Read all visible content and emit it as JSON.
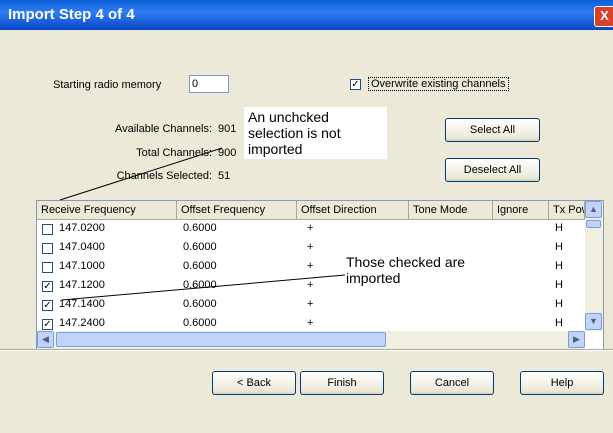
{
  "window": {
    "title": "Import Step 4 of 4",
    "close_label": "X"
  },
  "form": {
    "starting_memory_label": "Starting radio memory",
    "starting_memory_value": "0",
    "overwrite_label": "Overwrite existing channels",
    "overwrite_checked": true,
    "available_label": "Available Channels:",
    "available_value": "901",
    "total_label": "Total Channels:",
    "total_value": "900",
    "selected_label": "Channels Selected:",
    "selected_value": "51",
    "select_all": "Select All",
    "deselect_all": "Deselect All"
  },
  "annotations": {
    "unchecked_note": "An unchcked selection is not imported",
    "checked_note": "Those checked are imported"
  },
  "table": {
    "columns": [
      "Receive Frequency",
      "Offset Frequency",
      "Offset Direction",
      "Tone Mode",
      "Ignore",
      "Tx Power"
    ],
    "rows": [
      {
        "checked": false,
        "freq": "147.0200",
        "offset": "0.6000",
        "dir": "+",
        "tone": "",
        "ignore": "",
        "tx": "H"
      },
      {
        "checked": false,
        "freq": "147.0400",
        "offset": "0.6000",
        "dir": "+",
        "tone": "",
        "ignore": "",
        "tx": "H"
      },
      {
        "checked": false,
        "freq": "147.1000",
        "offset": "0.6000",
        "dir": "+",
        "tone": "",
        "ignore": "",
        "tx": "H"
      },
      {
        "checked": true,
        "freq": "147.1200",
        "offset": "0.6000",
        "dir": "+",
        "tone": "",
        "ignore": "",
        "tx": "H"
      },
      {
        "checked": true,
        "freq": "147.1400",
        "offset": "0.6000",
        "dir": "+",
        "tone": "",
        "ignore": "",
        "tx": "H"
      },
      {
        "checked": true,
        "freq": "147.2400",
        "offset": "0.6000",
        "dir": "+",
        "tone": "",
        "ignore": "",
        "tx": "H"
      }
    ]
  },
  "buttons": {
    "back": "< Back",
    "finish": "Finish",
    "cancel": "Cancel",
    "help": "Help"
  },
  "colors": {
    "title_bar": "#0a5ed6",
    "face": "#ece9d8",
    "note_bg": "#ffffff"
  }
}
